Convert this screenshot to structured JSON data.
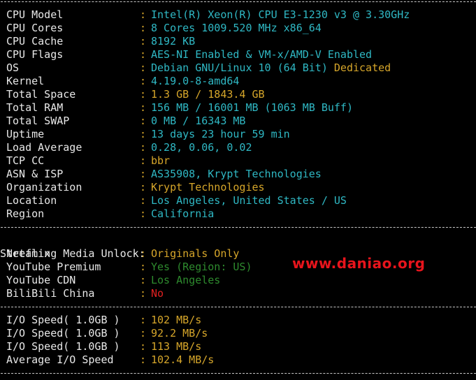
{
  "system_info": [
    {
      "label": "CPU Model",
      "value": "Intel(R) Xeon(R) CPU E3-1230 v3 @ 3.30GHz",
      "color": "cyan"
    },
    {
      "label": "CPU Cores",
      "value": "8 Cores 1009.520 MHz x86_64",
      "color": "cyan"
    },
    {
      "label": "CPU Cache",
      "value": "8192 KB",
      "color": "cyan"
    },
    {
      "label": "CPU Flags",
      "value": "AES-NI Enabled & VM-x/AMD-V Enabled",
      "color": "cyan"
    },
    {
      "label": "OS",
      "value": "Debian GNU/Linux 10 (64 Bit)",
      "color": "cyan",
      "extra": "Dedicated",
      "extra_color": "yellow"
    },
    {
      "label": "Kernel",
      "value": "4.19.0-8-amd64",
      "color": "cyan"
    },
    {
      "label": "Total Space",
      "value": "1.3 GB / 1843.4 GB",
      "color": "yellow"
    },
    {
      "label": "Total RAM",
      "value": "156 MB / 16001 MB (1063 MB Buff)",
      "color": "cyan"
    },
    {
      "label": "Total SWAP",
      "value": "0 MB / 16343 MB",
      "color": "cyan"
    },
    {
      "label": "Uptime",
      "value": "13 days 23 hour 59 min",
      "color": "cyan"
    },
    {
      "label": "Load Average",
      "value": "0.28, 0.06, 0.02",
      "color": "cyan"
    },
    {
      "label": "TCP CC",
      "value": "bbr",
      "color": "yellow"
    },
    {
      "label": "ASN & ISP",
      "value": "AS35908, Krypt Technologies",
      "color": "cyan"
    },
    {
      "label": "Organization",
      "value": "Krypt Technologies",
      "color": "yellow"
    },
    {
      "label": "Location",
      "value": "Los Angeles, United States / US",
      "color": "cyan"
    },
    {
      "label": "Region",
      "value": "California",
      "color": "cyan"
    }
  ],
  "streaming": {
    "title": "Streaming Media Unlock:",
    "items": [
      {
        "label": "Netflix",
        "value": "Originals Only",
        "color": "yellow"
      },
      {
        "label": "YouTube Premium",
        "value": "Yes (Region: US)",
        "color": "green"
      },
      {
        "label": "YouTube CDN",
        "value": "Los Angeles",
        "color": "green"
      },
      {
        "label": "BiliBili China",
        "value": "No",
        "color": "red"
      }
    ]
  },
  "io": [
    {
      "label": "I/O Speed( 1.0GB )",
      "value": "102 MB/s",
      "color": "yellow"
    },
    {
      "label": "I/O Speed( 1.0GB )",
      "value": "92.2 MB/s",
      "color": "yellow"
    },
    {
      "label": "I/O Speed( 1.0GB )",
      "value": "113 MB/s",
      "color": "yellow"
    },
    {
      "label": "Average I/O Speed",
      "value": "102.4 MB/s",
      "color": "yellow"
    }
  ],
  "separator_char": ":",
  "watermark": "www.daniao.org",
  "colors": {
    "background": "#000000",
    "label": "#e8e8e8",
    "cyan": "#2fb8c4",
    "yellow": "#d6a62a",
    "green": "#2e8b2e",
    "red": "#e02020",
    "watermark": "#e8141c"
  }
}
